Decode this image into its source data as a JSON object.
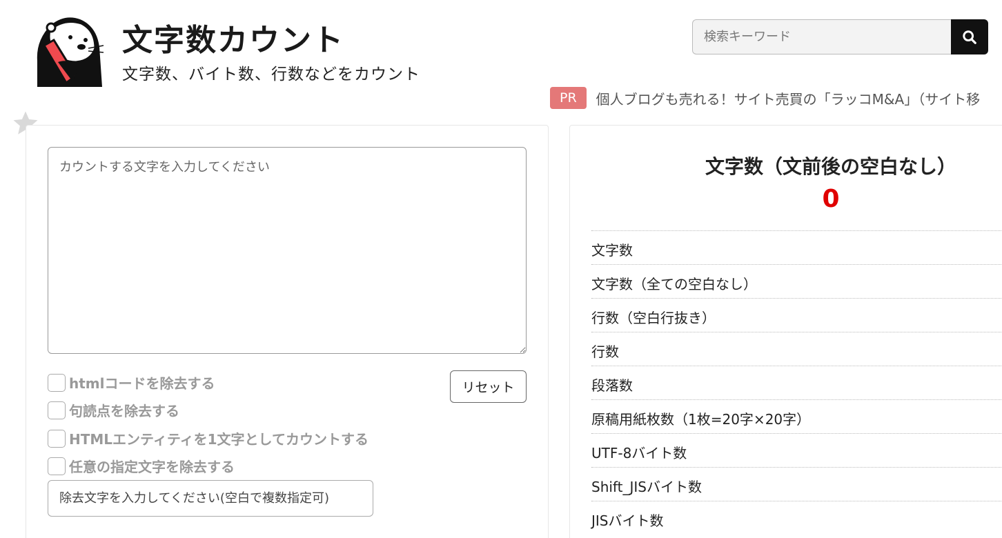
{
  "header": {
    "title": "文字数カウント",
    "subtitle": "文字数、バイト数、行数などをカウント",
    "logo_icon": "otter-mascot-icon"
  },
  "search": {
    "placeholder": "検索キーワード",
    "button_icon": "search-icon"
  },
  "pr": {
    "badge": "PR",
    "text": "個人ブログも売れる！サイト売買の「ラッコM&A」（サイト移"
  },
  "editor": {
    "placeholder": "カウントする文字を入力してください",
    "reset_label": "リセット",
    "options": [
      {
        "label": "htmlコードを除去する",
        "checked": false
      },
      {
        "label": "句読点を除去する",
        "checked": false
      },
      {
        "label": "HTMLエンティティを1文字としてカウントする",
        "checked": false
      },
      {
        "label": "任意の指定文字を除去する",
        "checked": false
      }
    ],
    "remove_placeholder": "除去文字を入力してください(空白で複数指定可)"
  },
  "results": {
    "title": "文字数（文前後の空白なし）",
    "value": "0",
    "rows": [
      {
        "label": "文字数"
      },
      {
        "label": "文字数（全ての空白なし）"
      },
      {
        "label": "行数（空白行抜き）"
      },
      {
        "label": "行数"
      },
      {
        "label": "段落数"
      },
      {
        "label": "原稿用紙枚数（1枚=20字×20字）"
      },
      {
        "label": "UTF-8バイト数"
      },
      {
        "label": "Shift_JISバイト数"
      },
      {
        "label": "JISバイト数"
      }
    ]
  },
  "colors": {
    "accent_red": "#e00000",
    "pr_badge": "#e47878"
  }
}
